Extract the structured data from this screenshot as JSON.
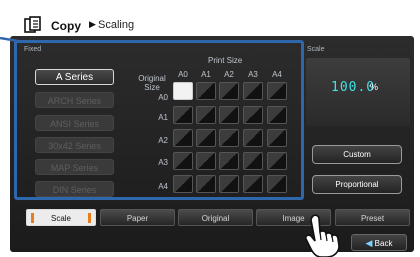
{
  "header": {
    "app_title": "Copy",
    "breadcrumb": "Scaling",
    "icon": "copy-document-icon"
  },
  "fixed": {
    "label": "Fixed",
    "series": [
      {
        "label": "A Series",
        "state": "active"
      },
      {
        "label": "ARCH Series",
        "state": "disabled"
      },
      {
        "label": "ANSI Series",
        "state": "disabled"
      },
      {
        "label": "30x42 Series",
        "state": "disabled"
      },
      {
        "label": "MAP Series",
        "state": "disabled"
      },
      {
        "label": "DIN Series",
        "state": "disabled"
      }
    ],
    "print_size_label": "Print Size",
    "original_size_label": "Original Size",
    "columns": [
      "A0",
      "A1",
      "A2",
      "A3",
      "A4"
    ],
    "rows": [
      "A0",
      "A1",
      "A2",
      "A3",
      "A4"
    ],
    "selected_cell": {
      "row": "A0",
      "column": "A0"
    }
  },
  "scale": {
    "label": "Scale",
    "value": "100.0",
    "unit": "%",
    "custom_label": "Custom",
    "proportional_label": "Proportional"
  },
  "tabs": [
    {
      "label": "Scale",
      "active": true
    },
    {
      "label": "Paper",
      "active": false
    },
    {
      "label": "Original",
      "active": false
    },
    {
      "label": "Image",
      "active": false
    },
    {
      "label": "Preset",
      "active": false
    }
  ],
  "back_label": "Back",
  "colors": {
    "highlight": "#2f67ad",
    "scale_value": "#3fe3e6",
    "tab_marker": "#e67d1f"
  }
}
